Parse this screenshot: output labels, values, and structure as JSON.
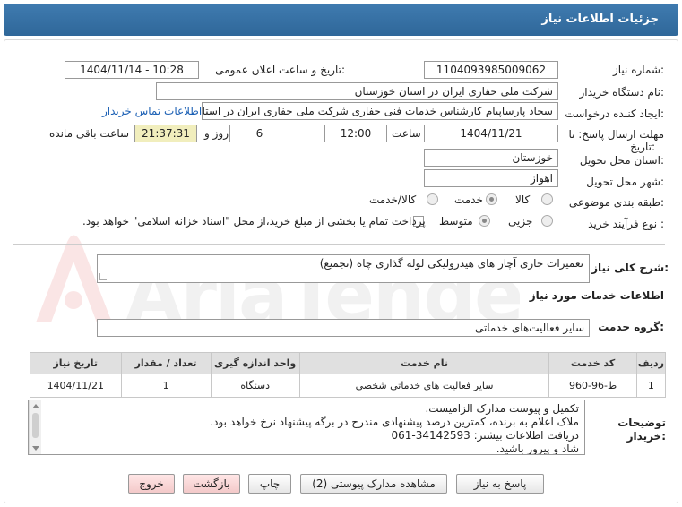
{
  "header": {
    "title": "جزئیات اطلاعات نیاز"
  },
  "fields": {
    "need_number_label": "شماره نیاز:",
    "need_number": "1104093985009062",
    "announce_label": "تاریخ و ساعت اعلان عمومی:",
    "announce_value": "1404/11/14 - 10:28",
    "buyer_label": "نام دستگاه خریدار:",
    "buyer_value": "شرکت ملی حفاری ایران در استان خوزستان",
    "creator_label": "ایجاد کننده درخواست:",
    "creator_value": "سجاد پارساپیام کارشناس خدمات فنی حفاری شرکت ملی حفاری ایران در استا",
    "contact_link": "اطلاعات تماس خریدار",
    "deadline_label_1": "مهلت ارسال پاسخ: تا",
    "deadline_label_2": "تاریخ:",
    "deadline_date": "1404/11/21",
    "time_label": "ساعت",
    "deadline_time": "12:00",
    "days_value": "6",
    "days_label": "روز و",
    "remaining_time": "21:37:31",
    "remaining_label": "ساعت باقی مانده",
    "province_label": "استان محل تحویل:",
    "province_value": "خوزستان",
    "city_label": "شهر محل تحویل:",
    "city_value": "اهواز",
    "category_label": "طبقه بندی موضوعی:",
    "category_options": [
      "کالا",
      "خدمت",
      "کالا/خدمت"
    ],
    "process_label": "نوع فرآیند خرید :",
    "process_options": [
      "جزیی",
      "متوسط"
    ],
    "payment_note": "پرداخت تمام یا بخشی از مبلغ خرید،از محل \"اسناد خزانه اسلامی\" خواهد بود."
  },
  "summary": {
    "label": "شرح کلی نیاز:",
    "value": "تعمیرات جاری آچار های هیدرولیکی لوله گذاری چاه (تجمیع)"
  },
  "services": {
    "section_title": "اطلاعات خدمات مورد نیاز",
    "group_label": "گروه خدمت:",
    "group_value": "سایر فعالیت‌های خدماتی",
    "columns": [
      "ردیف",
      "کد خدمت",
      "نام خدمت",
      "واحد اندازه گیری",
      "تعداد / مقدار",
      "تاریخ نیاز"
    ],
    "rows": [
      [
        "1",
        "ط-96-960",
        "سایر فعالیت های خدماتی شخصی",
        "دستگاه",
        "1",
        "1404/11/21"
      ]
    ]
  },
  "notes": {
    "label_1": "توضیحات",
    "label_2": "خریدار:",
    "lines": [
      "تکمیل و پیوست مدارک الزامیست.",
      "ملاک اعلام به برنده، کمترین درصد پیشنهادی مندرج در برگه پیشنهاد نرخ خواهد بود.",
      "دریافت اطلاعات بیشتر: 34142593-061",
      "شاد و پیروز باشید."
    ]
  },
  "watermark": {
    "text": "AriaTender.net"
  },
  "buttons": {
    "reply": "پاسخ به نیاز",
    "attachments": "مشاهده مدارک پیوستی (2)",
    "print": "چاپ",
    "back": "بازگشت",
    "exit": "خروج"
  },
  "colors": {
    "header": "#3576ab",
    "link": "#1a5fb4",
    "watermark": "#e04040"
  }
}
